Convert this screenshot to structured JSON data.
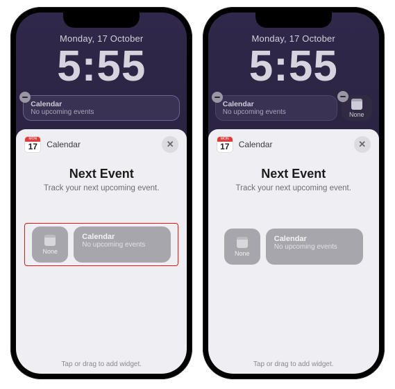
{
  "lockscreen": {
    "date": "Monday, 17 October",
    "time": "5:55"
  },
  "widget": {
    "title": "Calendar",
    "subtitle": "No upcoming events",
    "none_label": "None"
  },
  "sheet": {
    "app_name": "Calendar",
    "app_day_label": "MON",
    "app_day_number": "17",
    "title": "Next Event",
    "subtitle": "Track your next upcoming event.",
    "preview_small": "None",
    "preview_title": "Calendar",
    "preview_sub": "No upcoming events",
    "hint": "Tap or drag to add widget."
  }
}
